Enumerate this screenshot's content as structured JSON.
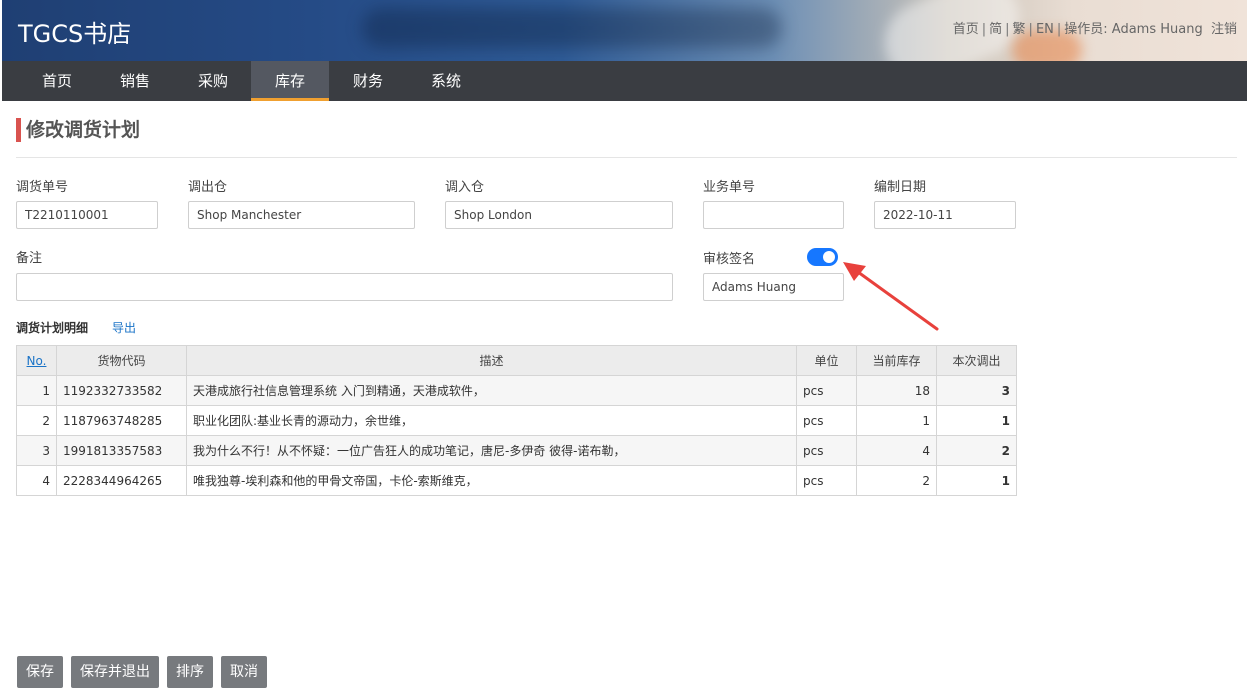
{
  "header": {
    "brand": "TGCS书店",
    "links": [
      "首页",
      "简",
      "繁",
      "EN"
    ],
    "operator_label": "操作员: Adams Huang",
    "logout": "注销"
  },
  "nav": {
    "items": [
      "首页",
      "销售",
      "采购",
      "库存",
      "财务",
      "系统"
    ],
    "active": "库存"
  },
  "page": {
    "title": "修改调货计划"
  },
  "form": {
    "transfer_no": {
      "label": "调货单号",
      "value": "T2210110001"
    },
    "from_warehouse": {
      "label": "调出仓",
      "value": "Shop Manchester"
    },
    "to_warehouse": {
      "label": "调入仓",
      "value": "Shop London"
    },
    "business_no": {
      "label": "业务单号",
      "value": ""
    },
    "date": {
      "label": "编制日期",
      "value": "2022-10-11"
    },
    "remark": {
      "label": "备注",
      "value": ""
    },
    "approval": {
      "label": "审核签名",
      "enabled": true,
      "value": "Adams Huang"
    }
  },
  "details": {
    "title": "调货计划明细",
    "export": "导出",
    "columns": [
      "No.",
      "货物代码",
      "描述",
      "单位",
      "当前库存",
      "本次调出"
    ],
    "rows": [
      {
        "no": "1",
        "code": "1192332733582",
        "desc": "天港成旅行社信息管理系统 入门到精通，天港成软件，",
        "unit": "pcs",
        "stock": "18",
        "qty": "3"
      },
      {
        "no": "2",
        "code": "1187963748285",
        "desc": "职业化团队:基业长青的源动力，余世维，",
        "unit": "pcs",
        "stock": "1",
        "qty": "1"
      },
      {
        "no": "3",
        "code": "1991813357583",
        "desc": "我为什么不行！从不怀疑：一位广告狂人的成功笔记，唐尼-多伊奇 彼得-诺布勒，",
        "unit": "pcs",
        "stock": "4",
        "qty": "2"
      },
      {
        "no": "4",
        "code": "2228344964265",
        "desc": "唯我独尊-埃利森和他的甲骨文帝国，卡伦-索斯维克，",
        "unit": "pcs",
        "stock": "2",
        "qty": "1"
      }
    ]
  },
  "buttons": {
    "save": "保存",
    "save_exit": "保存并退出",
    "sort": "排序",
    "cancel": "取消"
  },
  "colors": {
    "nav_bg": "#3a3d42",
    "accent": "#f0a030",
    "title_bar": "#d9534f",
    "toggle": "#1677ff",
    "arrow": "#e8413c"
  }
}
